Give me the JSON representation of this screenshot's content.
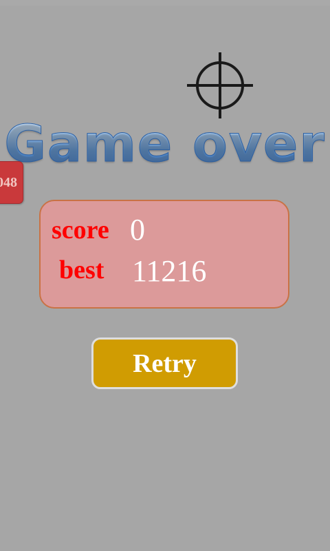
{
  "game": {
    "title": "Game over",
    "side_tile": "048",
    "score_label": "score",
    "score_value": "0",
    "best_label": "best",
    "best_value": "11216",
    "retry_label": "Retry"
  },
  "icons": {
    "crosshair": "crosshair-icon"
  },
  "colors": {
    "background": "#a6a6a6",
    "panel": "#dc9a9a",
    "panel_border": "#c97245",
    "label_red": "#ff0000",
    "button": "#d09c02",
    "title_blue": "#5a94d6",
    "tile_red": "#c9393b"
  }
}
